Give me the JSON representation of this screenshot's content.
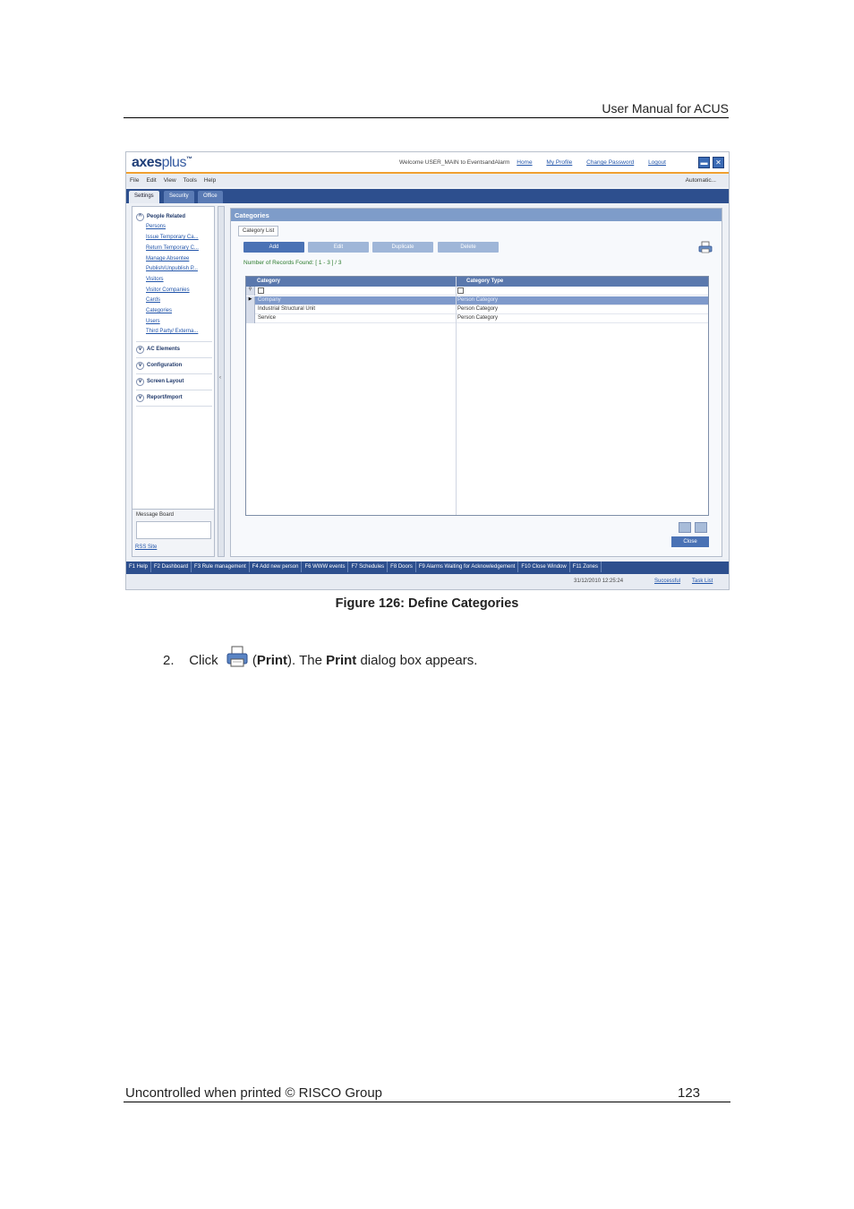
{
  "header": {
    "title": "User Manual for ACUS"
  },
  "footer": {
    "left": "Uncontrolled when printed © RISCO Group",
    "page": "123"
  },
  "caption": "Figure 126: Define Categories",
  "step": {
    "number": "2.",
    "click": "Click",
    "open": "(",
    "print1": "Print",
    "mid": "). The ",
    "print2": "Print",
    "rest": " dialog box appears."
  },
  "app": {
    "logo_main": "axes",
    "logo_plus": "plus",
    "logo_tm": "™",
    "welcome": "Welcome USER_MAIN to EventsandAlarm",
    "links": [
      "Home",
      "My Profile",
      "Change Password",
      "Logout"
    ],
    "menu": [
      "File",
      "Edit",
      "View",
      "Tools",
      "Help"
    ],
    "automatic": "Automatic...",
    "tabs": [
      "Settings",
      "Security",
      "Office"
    ],
    "sidebar": {
      "group1": "People Related",
      "items": [
        "Persons",
        "Issue Temporary Ca...",
        "Return Temporary C...",
        "Manage Absentee",
        "Publish/Unpublish P...",
        "Visitors",
        "Visitor Companies",
        "Cards",
        "Categories",
        "Users",
        "Third Party/ Externa..."
      ],
      "groups": [
        "AC Elements",
        "Configuration",
        "Screen Layout",
        "Report/Import"
      ],
      "message_board": "Message Board",
      "rss": "RSS Site"
    },
    "panel": {
      "title": "Categories",
      "subtab": "Category List",
      "buttons": [
        "Add",
        "Edit",
        "Duplicate",
        "Delete"
      ],
      "found": "Number of Records Found: [ 1 - 3 ] / 3",
      "columns": [
        "Category",
        "Category Type"
      ],
      "rows": [
        {
          "c1": "Company",
          "c2": "Person Category"
        },
        {
          "c1": "Industrial Structural Unit",
          "c2": "Person Category"
        },
        {
          "c1": "Service",
          "c2": "Person Category"
        }
      ],
      "close": "Close"
    },
    "fkeys": [
      "F1 Help",
      "F2 Dashboard",
      "F3 Rule management",
      "F4 Add new person",
      "F6 WWW events",
      "F7 Schedules",
      "F8 Doors",
      "F9 Alarms Waiting for Acknowledgement",
      "F10 Close Window",
      "F11 Zones"
    ],
    "status": {
      "datetime": "31/12/2010 12:25:24",
      "successful": "Successful",
      "tasklist": "Task List"
    }
  }
}
